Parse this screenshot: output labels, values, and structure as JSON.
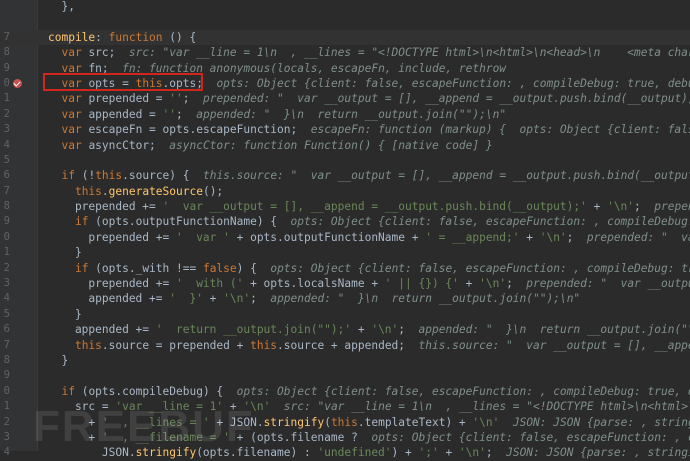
{
  "editor": {
    "breakpoint_line": "0",
    "watermark": "FREEBUF",
    "lines": [
      {
        "num": "",
        "hl": false,
        "tokens": [
          {
            "t": "txt",
            "v": "  },"
          }
        ]
      },
      {
        "num": "",
        "hl": false,
        "tokens": []
      },
      {
        "num": "7",
        "hl": true,
        "tokens": [
          {
            "t": "fn",
            "v": "compile"
          },
          {
            "t": "txt",
            "v": ": "
          },
          {
            "t": "kw",
            "v": "function"
          },
          {
            "t": "txt",
            "v": " () {"
          }
        ]
      },
      {
        "num": "8",
        "hl": false,
        "tokens": [
          {
            "t": "txt",
            "v": "  "
          },
          {
            "t": "kw",
            "v": "var"
          },
          {
            "t": "txt",
            "v": " src;  "
          },
          {
            "t": "hint",
            "v": "src: \"var __line = 1\\n  , __lines = \"<!DOCTYPE html>\\n<html>\\n<head>\\n    <meta charset=\\\"utf-8\\\">"
          }
        ]
      },
      {
        "num": "9",
        "hl": false,
        "tokens": [
          {
            "t": "txt",
            "v": "  "
          },
          {
            "t": "kw",
            "v": "var"
          },
          {
            "t": "txt",
            "v": " fn;  "
          },
          {
            "t": "hint",
            "v": "fn: function anonymous(locals, escapeFn, include, rethrow"
          }
        ]
      },
      {
        "num": "0",
        "hl": false,
        "tokens": [
          {
            "t": "txt",
            "v": "  "
          },
          {
            "t": "kw",
            "v": "var"
          },
          {
            "t": "txt",
            "v": " opts = "
          },
          {
            "t": "kw",
            "v": "this"
          },
          {
            "t": "txt",
            "v": ".opts;  "
          },
          {
            "t": "hint",
            "v": "opts: Object {client: false, escapeFunction: , compileDebug: true, debug: false"
          }
        ]
      },
      {
        "num": "1",
        "hl": false,
        "tokens": [
          {
            "t": "txt",
            "v": "  "
          },
          {
            "t": "kw",
            "v": "var"
          },
          {
            "t": "txt",
            "v": " prepended = "
          },
          {
            "t": "str",
            "v": "''"
          },
          {
            "t": "txt",
            "v": ";  "
          },
          {
            "t": "hint",
            "v": "prepended: \"  var __output = [], __append = __output.push.bind(__output);\\n  with"
          }
        ]
      },
      {
        "num": "2",
        "hl": false,
        "tokens": [
          {
            "t": "txt",
            "v": "  "
          },
          {
            "t": "kw",
            "v": "var"
          },
          {
            "t": "txt",
            "v": " appended = "
          },
          {
            "t": "str",
            "v": "''"
          },
          {
            "t": "txt",
            "v": ";  "
          },
          {
            "t": "hint",
            "v": "appended: \"  }\\n  return __output.join(\"\");\\n\""
          }
        ]
      },
      {
        "num": "3",
        "hl": false,
        "tokens": [
          {
            "t": "txt",
            "v": "  "
          },
          {
            "t": "kw",
            "v": "var"
          },
          {
            "t": "txt",
            "v": " escapeFn = opts.escapeFunction;  "
          },
          {
            "t": "hint",
            "v": "escapeFn: function (markup) {  opts: Object {client: false, escap"
          }
        ]
      },
      {
        "num": "4",
        "hl": false,
        "tokens": [
          {
            "t": "txt",
            "v": "  "
          },
          {
            "t": "kw",
            "v": "var"
          },
          {
            "t": "txt",
            "v": " asyncCtor;  "
          },
          {
            "t": "hint",
            "v": "asyncCtor: function Function() { [native code] }"
          }
        ]
      },
      {
        "num": "5",
        "hl": false,
        "tokens": []
      },
      {
        "num": "6",
        "hl": false,
        "tokens": [
          {
            "t": "txt",
            "v": "  "
          },
          {
            "t": "kw",
            "v": "if"
          },
          {
            "t": "txt",
            "v": " (!"
          },
          {
            "t": "kw",
            "v": "this"
          },
          {
            "t": "txt",
            "v": ".source) {  "
          },
          {
            "t": "hint",
            "v": "this.source: \"  var __output = [], __append = __output.push.bind(__output);\\n  wi"
          }
        ]
      },
      {
        "num": "7",
        "hl": false,
        "tokens": [
          {
            "t": "txt",
            "v": "    "
          },
          {
            "t": "kw",
            "v": "this"
          },
          {
            "t": "txt",
            "v": "."
          },
          {
            "t": "fn",
            "v": "generateSource"
          },
          {
            "t": "txt",
            "v": "();"
          }
        ]
      },
      {
        "num": "8",
        "hl": false,
        "tokens": [
          {
            "t": "txt",
            "v": "    prepended += "
          },
          {
            "t": "str",
            "v": "'  var __output = [], __append = __output.push.bind(__output);'"
          },
          {
            "t": "txt",
            "v": " + "
          },
          {
            "t": "str",
            "v": "'\\n'"
          },
          {
            "t": "txt",
            "v": ";  "
          },
          {
            "t": "hint",
            "v": "prepended: \"  var"
          }
        ]
      },
      {
        "num": "9",
        "hl": false,
        "tokens": [
          {
            "t": "txt",
            "v": "    "
          },
          {
            "t": "kw",
            "v": "if"
          },
          {
            "t": "txt",
            "v": " (opts.outputFunctionName) {  "
          },
          {
            "t": "hint",
            "v": "opts: Object {client: false, escapeFunction: , compileDebug: true, de"
          }
        ]
      },
      {
        "num": "0",
        "hl": false,
        "tokens": [
          {
            "t": "txt",
            "v": "      prepended += "
          },
          {
            "t": "str",
            "v": "'  var '"
          },
          {
            "t": "txt",
            "v": " + opts.outputFunctionName + "
          },
          {
            "t": "str",
            "v": "' = __append;'"
          },
          {
            "t": "txt",
            "v": " + "
          },
          {
            "t": "str",
            "v": "'\\n'"
          },
          {
            "t": "txt",
            "v": ";  "
          },
          {
            "t": "hint",
            "v": "prepended: \"  var __outp"
          }
        ]
      },
      {
        "num": "1",
        "hl": false,
        "tokens": [
          {
            "t": "txt",
            "v": "    }"
          }
        ]
      },
      {
        "num": "2",
        "hl": false,
        "tokens": [
          {
            "t": "txt",
            "v": "    "
          },
          {
            "t": "kw",
            "v": "if"
          },
          {
            "t": "txt",
            "v": " (opts._with !== "
          },
          {
            "t": "kw",
            "v": "false"
          },
          {
            "t": "txt",
            "v": ") {  "
          },
          {
            "t": "hint",
            "v": "opts: Object {client: false, escapeFunction: , compileDebug: true, debug: fa"
          }
        ]
      },
      {
        "num": "3",
        "hl": false,
        "tokens": [
          {
            "t": "txt",
            "v": "      prepended += "
          },
          {
            "t": "str",
            "v": "'  with ('"
          },
          {
            "t": "txt",
            "v": " + opts.localsName + "
          },
          {
            "t": "str",
            "v": "' || {}) {'"
          },
          {
            "t": "txt",
            "v": " + "
          },
          {
            "t": "str",
            "v": "'\\n'"
          },
          {
            "t": "txt",
            "v": ";  "
          },
          {
            "t": "hint",
            "v": "prepended: \"  var __output = ["
          }
        ]
      },
      {
        "num": "4",
        "hl": false,
        "tokens": [
          {
            "t": "txt",
            "v": "      appended += "
          },
          {
            "t": "str",
            "v": "'  }'"
          },
          {
            "t": "txt",
            "v": " + "
          },
          {
            "t": "str",
            "v": "'\\n'"
          },
          {
            "t": "txt",
            "v": ";  "
          },
          {
            "t": "hint",
            "v": "appended: \"  }\\n  return __output.join(\"\");\\n\""
          }
        ]
      },
      {
        "num": "5",
        "hl": false,
        "tokens": [
          {
            "t": "txt",
            "v": "    }"
          }
        ]
      },
      {
        "num": "6",
        "hl": false,
        "tokens": [
          {
            "t": "txt",
            "v": "    appended += "
          },
          {
            "t": "str",
            "v": "'  return __output.join(\"\");'"
          },
          {
            "t": "txt",
            "v": " + "
          },
          {
            "t": "str",
            "v": "'\\n'"
          },
          {
            "t": "txt",
            "v": ";  "
          },
          {
            "t": "hint",
            "v": "appended: \"  }\\n  return __output.join(\"\");\\n\""
          }
        ]
      },
      {
        "num": "7",
        "hl": false,
        "tokens": [
          {
            "t": "txt",
            "v": "    "
          },
          {
            "t": "kw",
            "v": "this"
          },
          {
            "t": "txt",
            "v": ".source = prepended + "
          },
          {
            "t": "kw",
            "v": "this"
          },
          {
            "t": "txt",
            "v": ".source + appended;  "
          },
          {
            "t": "hint",
            "v": "this.source: \"  var __output = [], __append = __output.pu"
          }
        ]
      },
      {
        "num": "8",
        "hl": false,
        "tokens": [
          {
            "t": "txt",
            "v": "  }"
          }
        ]
      },
      {
        "num": "9",
        "hl": false,
        "tokens": []
      },
      {
        "num": "0",
        "hl": false,
        "tokens": [
          {
            "t": "txt",
            "v": "  "
          },
          {
            "t": "kw",
            "v": "if"
          },
          {
            "t": "txt",
            "v": " (opts.compileDebug) {  "
          },
          {
            "t": "hint",
            "v": "opts: Object {client: false, escapeFunction: , compileDebug: true, debug: false"
          }
        ]
      },
      {
        "num": "1",
        "hl": false,
        "tokens": [
          {
            "t": "txt",
            "v": "    src = "
          },
          {
            "t": "str",
            "v": "'var __line = 1'"
          },
          {
            "t": "txt",
            "v": " + "
          },
          {
            "t": "str",
            "v": "'\\n'"
          },
          {
            "t": "txt",
            "v": "  "
          },
          {
            "t": "hint",
            "v": "src: \"var __line = 1\\n  , __lines = \"<!DOCTYPE html>\\n<html>\\n<head>\\n"
          }
        ]
      },
      {
        "num": "2",
        "hl": false,
        "tokens": [
          {
            "t": "txt",
            "v": "      + "
          },
          {
            "t": "str",
            "v": "'  , __lines = '"
          },
          {
            "t": "txt",
            "v": " + JSON."
          },
          {
            "t": "fn",
            "v": "stringify"
          },
          {
            "t": "txt",
            "v": "("
          },
          {
            "t": "kw",
            "v": "this"
          },
          {
            "t": "txt",
            "v": ".templateText) + "
          },
          {
            "t": "str",
            "v": "'\\n'"
          },
          {
            "t": "txt",
            "v": "  "
          },
          {
            "t": "hint",
            "v": "JSON: JSON {parse: , stringify: , Sy"
          }
        ]
      },
      {
        "num": "3",
        "hl": false,
        "tokens": [
          {
            "t": "txt",
            "v": "      + "
          },
          {
            "t": "str",
            "v": "'  , __filename = '"
          },
          {
            "t": "txt",
            "v": " + (opts.filename ?  "
          },
          {
            "t": "hint",
            "v": "opts: Object {client: false, escapeFunction: , compileDebug"
          }
        ]
      },
      {
        "num": "4",
        "hl": false,
        "tokens": [
          {
            "t": "txt",
            "v": "        JSON."
          },
          {
            "t": "fn",
            "v": "stringify"
          },
          {
            "t": "txt",
            "v": "(opts.filename) : "
          },
          {
            "t": "str",
            "v": "'undefined'"
          },
          {
            "t": "txt",
            "v": ") + "
          },
          {
            "t": "str",
            "v": "';'"
          },
          {
            "t": "txt",
            "v": " + "
          },
          {
            "t": "str",
            "v": "'\\n'"
          },
          {
            "t": "txt",
            "v": ";  "
          },
          {
            "t": "hint",
            "v": "JSON: JSON {parse: , stringify: , Symbol"
          }
        ]
      }
    ]
  }
}
